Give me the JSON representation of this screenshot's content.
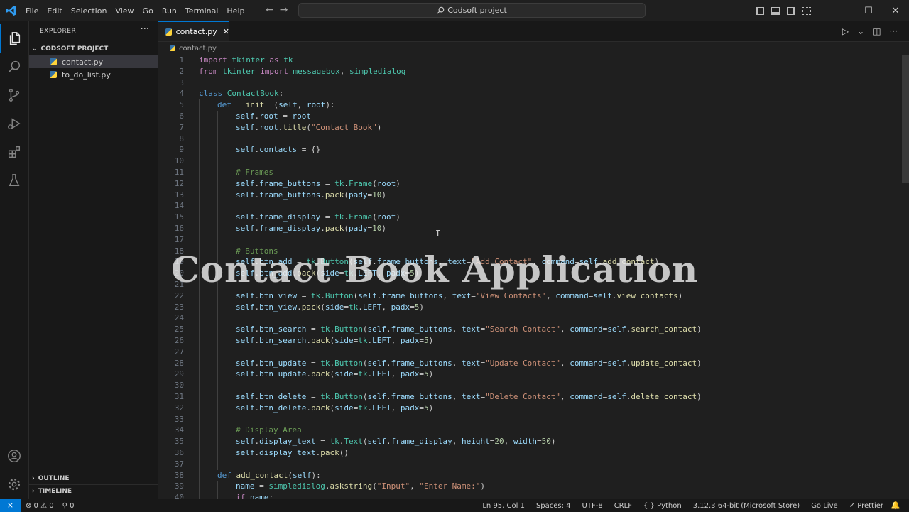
{
  "menu": [
    "File",
    "Edit",
    "Selection",
    "View",
    "Go",
    "Run",
    "Terminal",
    "Help"
  ],
  "nav": {
    "back": "←",
    "forward": "→"
  },
  "command_center": "Codsoft project",
  "window_controls": {
    "minimize": "—",
    "maximize": "☐",
    "close": "✕"
  },
  "explorer": {
    "title": "EXPLORER",
    "more": "···",
    "project": "CODSOFT PROJECT",
    "files": [
      "contact.py",
      "to_do_list.py"
    ],
    "outline": "OUTLINE",
    "timeline": "TIMELINE"
  },
  "tab": {
    "label": "contact.py",
    "close": "✕"
  },
  "breadcrumb": "contact.py",
  "watermark": "Contact Book Application",
  "code_lines": [
    [
      1,
      0,
      [
        [
          "kw",
          "import"
        ],
        [
          "",
          ""
        ],
        [
          "cls",
          " tkinter"
        ],
        [
          "kw",
          " as"
        ],
        [
          "cls",
          " tk"
        ]
      ]
    ],
    [
      2,
      0,
      [
        [
          "kw",
          "from"
        ],
        [
          "cls",
          " tkinter"
        ],
        [
          "kw",
          " import"
        ],
        [
          "cls",
          " messagebox"
        ],
        [
          "",
          ", "
        ],
        [
          "cls",
          "simpledialog"
        ]
      ]
    ],
    [
      3,
      0,
      []
    ],
    [
      4,
      0,
      [
        [
          "kb",
          "class"
        ],
        [
          "cls",
          " ContactBook"
        ],
        [
          "",
          ":"
        ]
      ]
    ],
    [
      5,
      1,
      [
        [
          "kb",
          "def"
        ],
        [
          "fn",
          " __init__"
        ],
        [
          "",
          "("
        ],
        [
          "var",
          "self"
        ],
        [
          "",
          ", "
        ],
        [
          "var",
          "root"
        ],
        [
          "",
          "):"
        ]
      ]
    ],
    [
      6,
      2,
      [
        [
          "var",
          "self"
        ],
        [
          "",
          "."
        ],
        [
          "var",
          "root"
        ],
        [
          "",
          " = "
        ],
        [
          "var",
          "root"
        ]
      ]
    ],
    [
      7,
      2,
      [
        [
          "var",
          "self"
        ],
        [
          "",
          "."
        ],
        [
          "var",
          "root"
        ],
        [
          "",
          "."
        ],
        [
          "fn",
          "title"
        ],
        [
          "",
          "("
        ],
        [
          "str",
          "\"Contact Book\""
        ],
        [
          "",
          ")"
        ]
      ]
    ],
    [
      8,
      2,
      []
    ],
    [
      9,
      2,
      [
        [
          "var",
          "self"
        ],
        [
          "",
          "."
        ],
        [
          "var",
          "contacts"
        ],
        [
          "",
          " = {}"
        ]
      ]
    ],
    [
      10,
      2,
      []
    ],
    [
      11,
      2,
      [
        [
          "cmt",
          "# Frames"
        ]
      ]
    ],
    [
      12,
      2,
      [
        [
          "var",
          "self"
        ],
        [
          "",
          "."
        ],
        [
          "var",
          "frame_buttons"
        ],
        [
          "",
          " = "
        ],
        [
          "cls",
          "tk"
        ],
        [
          "",
          "."
        ],
        [
          "cls",
          "Frame"
        ],
        [
          "",
          "("
        ],
        [
          "var",
          "root"
        ],
        [
          "",
          ")"
        ]
      ]
    ],
    [
      13,
      2,
      [
        [
          "var",
          "self"
        ],
        [
          "",
          "."
        ],
        [
          "var",
          "frame_buttons"
        ],
        [
          "",
          "."
        ],
        [
          "fn",
          "pack"
        ],
        [
          "",
          "("
        ],
        [
          "var",
          "pady"
        ],
        [
          "",
          "="
        ],
        [
          "num",
          "10"
        ],
        [
          "",
          ")"
        ]
      ]
    ],
    [
      14,
      2,
      []
    ],
    [
      15,
      2,
      [
        [
          "var",
          "self"
        ],
        [
          "",
          "."
        ],
        [
          "var",
          "frame_display"
        ],
        [
          "",
          " = "
        ],
        [
          "cls",
          "tk"
        ],
        [
          "",
          "."
        ],
        [
          "cls",
          "Frame"
        ],
        [
          "",
          "("
        ],
        [
          "var",
          "root"
        ],
        [
          "",
          ")"
        ]
      ]
    ],
    [
      16,
      2,
      [
        [
          "var",
          "self"
        ],
        [
          "",
          "."
        ],
        [
          "var",
          "frame_display"
        ],
        [
          "",
          "."
        ],
        [
          "fn",
          "pack"
        ],
        [
          "",
          "("
        ],
        [
          "var",
          "pady"
        ],
        [
          "",
          "="
        ],
        [
          "num",
          "10"
        ],
        [
          "",
          ")"
        ]
      ]
    ],
    [
      17,
      2,
      []
    ],
    [
      18,
      2,
      [
        [
          "cmt",
          "# Buttons"
        ]
      ]
    ],
    [
      19,
      2,
      [
        [
          "var",
          "self"
        ],
        [
          "",
          "."
        ],
        [
          "var",
          "btn_add"
        ],
        [
          "",
          " = "
        ],
        [
          "cls",
          "tk"
        ],
        [
          "",
          "."
        ],
        [
          "cls",
          "Button"
        ],
        [
          "",
          "("
        ],
        [
          "var",
          "self"
        ],
        [
          "",
          "."
        ],
        [
          "var",
          "frame_buttons"
        ],
        [
          "",
          ", "
        ],
        [
          "var",
          "text"
        ],
        [
          "",
          "="
        ],
        [
          "str",
          "\"Add Contact\""
        ],
        [
          "",
          ", "
        ],
        [
          "var",
          "command"
        ],
        [
          "",
          "="
        ],
        [
          "var",
          "self"
        ],
        [
          "",
          "."
        ],
        [
          "fn",
          "add_contact"
        ],
        [
          "",
          ")"
        ]
      ]
    ],
    [
      20,
      2,
      [
        [
          "var",
          "self"
        ],
        [
          "",
          "."
        ],
        [
          "var",
          "btn_add"
        ],
        [
          "",
          "."
        ],
        [
          "fn",
          "pack"
        ],
        [
          "",
          "("
        ],
        [
          "var",
          "side"
        ],
        [
          "",
          "="
        ],
        [
          "cls",
          "tk"
        ],
        [
          "",
          "."
        ],
        [
          "var",
          "LEFT"
        ],
        [
          "",
          ", "
        ],
        [
          "var",
          "padx"
        ],
        [
          "",
          "="
        ],
        [
          "num",
          "5"
        ],
        [
          "",
          ")"
        ]
      ]
    ],
    [
      21,
      2,
      []
    ],
    [
      22,
      2,
      [
        [
          "var",
          "self"
        ],
        [
          "",
          "."
        ],
        [
          "var",
          "btn_view"
        ],
        [
          "",
          " = "
        ],
        [
          "cls",
          "tk"
        ],
        [
          "",
          "."
        ],
        [
          "cls",
          "Button"
        ],
        [
          "",
          "("
        ],
        [
          "var",
          "self"
        ],
        [
          "",
          "."
        ],
        [
          "var",
          "frame_buttons"
        ],
        [
          "",
          ", "
        ],
        [
          "var",
          "text"
        ],
        [
          "",
          "="
        ],
        [
          "str",
          "\"View Contacts\""
        ],
        [
          "",
          ", "
        ],
        [
          "var",
          "command"
        ],
        [
          "",
          "="
        ],
        [
          "var",
          "self"
        ],
        [
          "",
          "."
        ],
        [
          "fn",
          "view_contacts"
        ],
        [
          "",
          ")"
        ]
      ]
    ],
    [
      23,
      2,
      [
        [
          "var",
          "self"
        ],
        [
          "",
          "."
        ],
        [
          "var",
          "btn_view"
        ],
        [
          "",
          "."
        ],
        [
          "fn",
          "pack"
        ],
        [
          "",
          "("
        ],
        [
          "var",
          "side"
        ],
        [
          "",
          "="
        ],
        [
          "cls",
          "tk"
        ],
        [
          "",
          "."
        ],
        [
          "var",
          "LEFT"
        ],
        [
          "",
          ", "
        ],
        [
          "var",
          "padx"
        ],
        [
          "",
          "="
        ],
        [
          "num",
          "5"
        ],
        [
          "",
          ")"
        ]
      ]
    ],
    [
      24,
      2,
      []
    ],
    [
      25,
      2,
      [
        [
          "var",
          "self"
        ],
        [
          "",
          "."
        ],
        [
          "var",
          "btn_search"
        ],
        [
          "",
          " = "
        ],
        [
          "cls",
          "tk"
        ],
        [
          "",
          "."
        ],
        [
          "cls",
          "Button"
        ],
        [
          "",
          "("
        ],
        [
          "var",
          "self"
        ],
        [
          "",
          "."
        ],
        [
          "var",
          "frame_buttons"
        ],
        [
          "",
          ", "
        ],
        [
          "var",
          "text"
        ],
        [
          "",
          "="
        ],
        [
          "str",
          "\"Search Contact\""
        ],
        [
          "",
          ", "
        ],
        [
          "var",
          "command"
        ],
        [
          "",
          "="
        ],
        [
          "var",
          "self"
        ],
        [
          "",
          "."
        ],
        [
          "fn",
          "search_contact"
        ],
        [
          "",
          ")"
        ]
      ]
    ],
    [
      26,
      2,
      [
        [
          "var",
          "self"
        ],
        [
          "",
          "."
        ],
        [
          "var",
          "btn_search"
        ],
        [
          "",
          "."
        ],
        [
          "fn",
          "pack"
        ],
        [
          "",
          "("
        ],
        [
          "var",
          "side"
        ],
        [
          "",
          "="
        ],
        [
          "cls",
          "tk"
        ],
        [
          "",
          "."
        ],
        [
          "var",
          "LEFT"
        ],
        [
          "",
          ", "
        ],
        [
          "var",
          "padx"
        ],
        [
          "",
          "="
        ],
        [
          "num",
          "5"
        ],
        [
          "",
          ")"
        ]
      ]
    ],
    [
      27,
      2,
      []
    ],
    [
      28,
      2,
      [
        [
          "var",
          "self"
        ],
        [
          "",
          "."
        ],
        [
          "var",
          "btn_update"
        ],
        [
          "",
          " = "
        ],
        [
          "cls",
          "tk"
        ],
        [
          "",
          "."
        ],
        [
          "cls",
          "Button"
        ],
        [
          "",
          "("
        ],
        [
          "var",
          "self"
        ],
        [
          "",
          "."
        ],
        [
          "var",
          "frame_buttons"
        ],
        [
          "",
          ", "
        ],
        [
          "var",
          "text"
        ],
        [
          "",
          "="
        ],
        [
          "str",
          "\"Update Contact\""
        ],
        [
          "",
          ", "
        ],
        [
          "var",
          "command"
        ],
        [
          "",
          "="
        ],
        [
          "var",
          "self"
        ],
        [
          "",
          "."
        ],
        [
          "fn",
          "update_contact"
        ],
        [
          "",
          ")"
        ]
      ]
    ],
    [
      29,
      2,
      [
        [
          "var",
          "self"
        ],
        [
          "",
          "."
        ],
        [
          "var",
          "btn_update"
        ],
        [
          "",
          "."
        ],
        [
          "fn",
          "pack"
        ],
        [
          "",
          "("
        ],
        [
          "var",
          "side"
        ],
        [
          "",
          "="
        ],
        [
          "cls",
          "tk"
        ],
        [
          "",
          "."
        ],
        [
          "var",
          "LEFT"
        ],
        [
          "",
          ", "
        ],
        [
          "var",
          "padx"
        ],
        [
          "",
          "="
        ],
        [
          "num",
          "5"
        ],
        [
          "",
          ")"
        ]
      ]
    ],
    [
      30,
      2,
      []
    ],
    [
      31,
      2,
      [
        [
          "var",
          "self"
        ],
        [
          "",
          "."
        ],
        [
          "var",
          "btn_delete"
        ],
        [
          "",
          " = "
        ],
        [
          "cls",
          "tk"
        ],
        [
          "",
          "."
        ],
        [
          "cls",
          "Button"
        ],
        [
          "",
          "("
        ],
        [
          "var",
          "self"
        ],
        [
          "",
          "."
        ],
        [
          "var",
          "frame_buttons"
        ],
        [
          "",
          ", "
        ],
        [
          "var",
          "text"
        ],
        [
          "",
          "="
        ],
        [
          "str",
          "\"Delete Contact\""
        ],
        [
          "",
          ", "
        ],
        [
          "var",
          "command"
        ],
        [
          "",
          "="
        ],
        [
          "var",
          "self"
        ],
        [
          "",
          "."
        ],
        [
          "fn",
          "delete_contact"
        ],
        [
          "",
          ")"
        ]
      ]
    ],
    [
      32,
      2,
      [
        [
          "var",
          "self"
        ],
        [
          "",
          "."
        ],
        [
          "var",
          "btn_delete"
        ],
        [
          "",
          "."
        ],
        [
          "fn",
          "pack"
        ],
        [
          "",
          "("
        ],
        [
          "var",
          "side"
        ],
        [
          "",
          "="
        ],
        [
          "cls",
          "tk"
        ],
        [
          "",
          "."
        ],
        [
          "var",
          "LEFT"
        ],
        [
          "",
          ", "
        ],
        [
          "var",
          "padx"
        ],
        [
          "",
          "="
        ],
        [
          "num",
          "5"
        ],
        [
          "",
          ")"
        ]
      ]
    ],
    [
      33,
      2,
      []
    ],
    [
      34,
      2,
      [
        [
          "cmt",
          "# Display Area"
        ]
      ]
    ],
    [
      35,
      2,
      [
        [
          "var",
          "self"
        ],
        [
          "",
          "."
        ],
        [
          "var",
          "display_text"
        ],
        [
          "",
          " = "
        ],
        [
          "cls",
          "tk"
        ],
        [
          "",
          "."
        ],
        [
          "cls",
          "Text"
        ],
        [
          "",
          "("
        ],
        [
          "var",
          "self"
        ],
        [
          "",
          "."
        ],
        [
          "var",
          "frame_display"
        ],
        [
          "",
          ", "
        ],
        [
          "var",
          "height"
        ],
        [
          "",
          "="
        ],
        [
          "num",
          "20"
        ],
        [
          "",
          ", "
        ],
        [
          "var",
          "width"
        ],
        [
          "",
          "="
        ],
        [
          "num",
          "50"
        ],
        [
          "",
          ")"
        ]
      ]
    ],
    [
      36,
      2,
      [
        [
          "var",
          "self"
        ],
        [
          "",
          "."
        ],
        [
          "var",
          "display_text"
        ],
        [
          "",
          "."
        ],
        [
          "fn",
          "pack"
        ],
        [
          "",
          "()"
        ]
      ]
    ],
    [
      37,
      2,
      []
    ],
    [
      38,
      1,
      [
        [
          "kb",
          "def"
        ],
        [
          "fn",
          " add_contact"
        ],
        [
          "",
          "("
        ],
        [
          "var",
          "self"
        ],
        [
          "",
          "):"
        ]
      ]
    ],
    [
      39,
      2,
      [
        [
          "var",
          "name"
        ],
        [
          "",
          " = "
        ],
        [
          "cls",
          "simpledialog"
        ],
        [
          "",
          "."
        ],
        [
          "fn",
          "askstring"
        ],
        [
          "",
          "("
        ],
        [
          "str",
          "\"Input\""
        ],
        [
          "",
          ", "
        ],
        [
          "str",
          "\"Enter Name:\""
        ],
        [
          "",
          ")"
        ]
      ]
    ],
    [
      40,
      2,
      [
        [
          "kw",
          "if"
        ],
        [
          "var",
          " name"
        ],
        [
          "",
          ":"
        ]
      ]
    ]
  ],
  "status": {
    "remote": "⨯",
    "problems": "⊗ 0 ⚠ 0",
    "ports": "⚲ 0",
    "position": "Ln 95, Col 1",
    "spaces": "Spaces: 4",
    "encoding": "UTF-8",
    "eol": "CRLF",
    "language": "{ } Python",
    "interpreter": "3.12.3 64-bit (Microsoft Store)",
    "golive": "Go Live",
    "prettier": "✓ Prettier",
    "bell": "🔔"
  }
}
